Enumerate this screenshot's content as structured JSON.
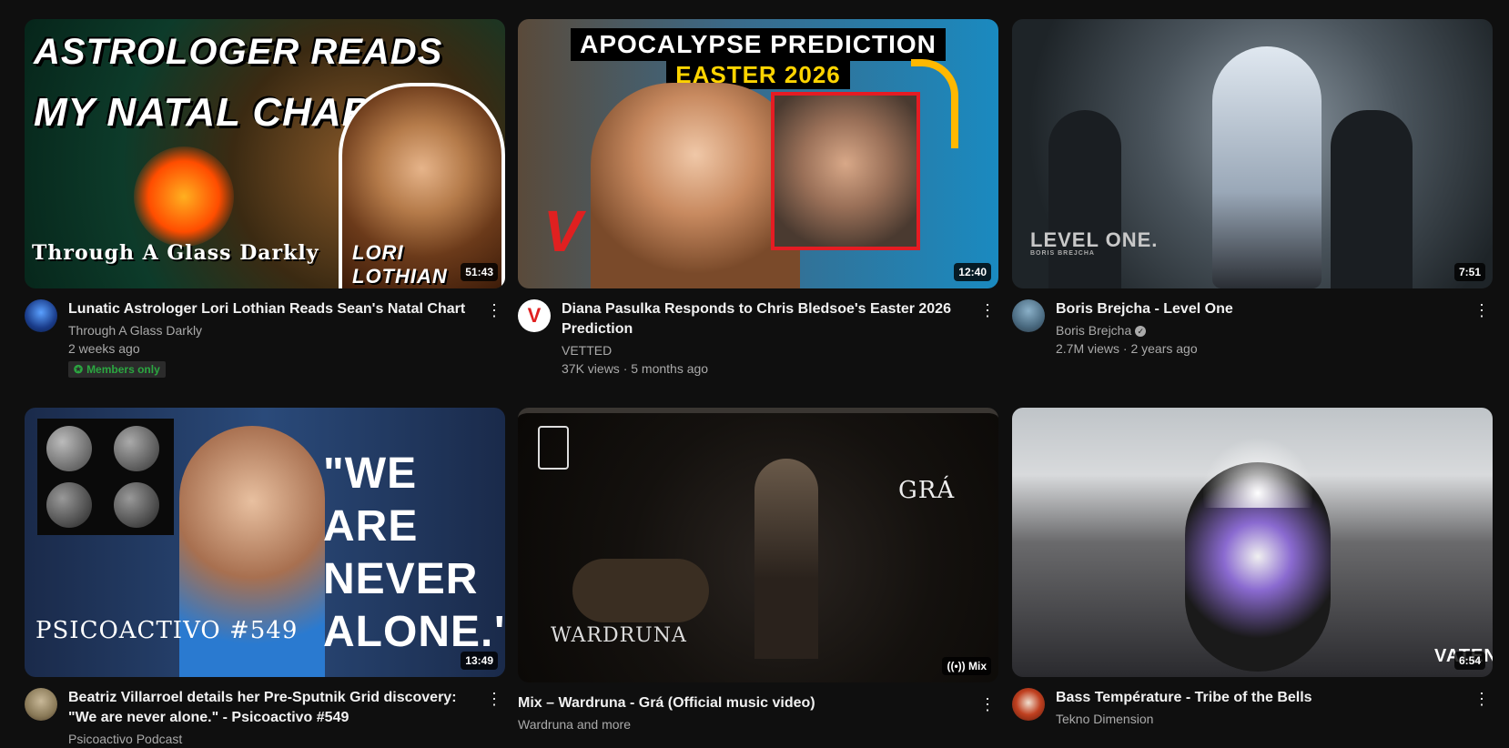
{
  "videos": [
    {
      "thumb_text": {
        "line1": "ASTROLOGER READS",
        "line2": "MY NATAL CHART",
        "footer": "Through A Glass Darkly",
        "name": "LORI LOTHIAN"
      },
      "duration": "51:43",
      "title": "Lunatic Astrologer Lori Lothian Reads Sean's Natal Chart",
      "channel": "Through A Glass Darkly",
      "stats": "2 weeks ago",
      "badge": "Members only",
      "menu": "⋮"
    },
    {
      "thumb_text": {
        "line1": "APOCALYPSE PREDICTION",
        "line2": "EASTER 2026",
        "logo": "V"
      },
      "duration": "12:40",
      "title": "Diana Pasulka Responds to Chris Bledsoe's Easter 2026 Prediction",
      "channel": "VETTED",
      "stats": "37K views · 5 months ago",
      "menu": "⋮"
    },
    {
      "thumb_text": {
        "line1": "LEVEL ONE.",
        "line2": "BORIS BREJCHA"
      },
      "duration": "7:51",
      "title": "Boris Brejcha - Level One",
      "channel": "Boris Brejcha",
      "stats": "2.7M views · 2 years ago",
      "menu": "⋮"
    },
    {
      "thumb_text": {
        "line1": "\"WE ARE",
        "line2": "NEVER",
        "line3": "ALONE.\"",
        "footer": "PSICOACTIVO #549"
      },
      "duration": "13:49",
      "title": "Beatriz Villarroel details her Pre-Sputnik Grid discovery: \"We are never alone.\" - Psicoactivo #549",
      "channel": "Psicoactivo Podcast",
      "stats": "",
      "menu": "⋮"
    },
    {
      "thumb_text": {
        "line1": "GRÁ",
        "line2": "WARDRUNA"
      },
      "duration": "Mix",
      "title": "Mix – Wardruna - Grá (Official music video)",
      "channel": "Wardruna and more",
      "stats": "",
      "menu": "⋮"
    },
    {
      "thumb_text": {
        "line1": "VATEN"
      },
      "duration": "6:54",
      "title": "Bass Température - Tribe of the Bells",
      "channel": "Tekno Dimension",
      "stats": "",
      "menu": "⋮"
    }
  ]
}
